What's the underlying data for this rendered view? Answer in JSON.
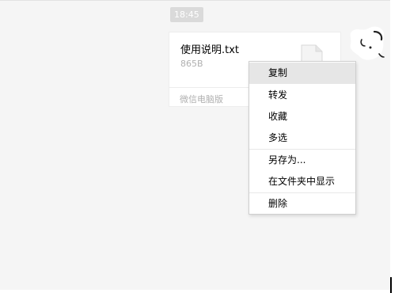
{
  "chat": {
    "timestamp": "18:45",
    "file_message": {
      "file_name": "使用说明.txt",
      "file_size": "865B",
      "source_label": "微信电脑版",
      "file_icon": "document-icon"
    },
    "sender_avatar": "avatar-icon"
  },
  "context_menu": {
    "items": [
      {
        "label": "复制",
        "highlighted": true
      },
      {
        "label": "转发"
      },
      {
        "label": "收藏"
      },
      {
        "label": "多选"
      },
      {
        "label": "另存为..."
      },
      {
        "label": "在文件夹中显示"
      },
      {
        "label": "删除"
      }
    ]
  },
  "colors": {
    "chat_background": "#f5f5f5",
    "card_background": "#ffffff",
    "menu_highlight": "#e6e6e6",
    "timestamp_background": "#dadada",
    "muted_text": "#b0b0b0"
  }
}
